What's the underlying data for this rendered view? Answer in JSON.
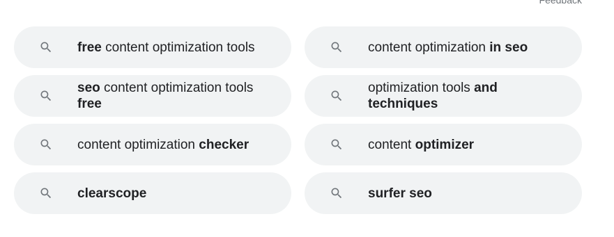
{
  "feedback_label": "Feedback",
  "icon": "search-icon",
  "colors": {
    "pill_background": "#f1f3f4",
    "text": "#202124",
    "icon": "#70757a"
  },
  "suggestions": [
    {
      "parts": [
        {
          "text": "free",
          "bold": true
        },
        {
          "text": " content optimization tools",
          "bold": false
        }
      ]
    },
    {
      "parts": [
        {
          "text": "content optimization ",
          "bold": false
        },
        {
          "text": "in seo",
          "bold": true
        }
      ]
    },
    {
      "parts": [
        {
          "text": "seo",
          "bold": true
        },
        {
          "text": " content optimization tools ",
          "bold": false
        },
        {
          "text": "free",
          "bold": true
        }
      ]
    },
    {
      "parts": [
        {
          "text": "optimization tools ",
          "bold": false
        },
        {
          "text": "and techniques",
          "bold": true
        }
      ]
    },
    {
      "parts": [
        {
          "text": "content optimization ",
          "bold": false
        },
        {
          "text": "checker",
          "bold": true
        }
      ]
    },
    {
      "parts": [
        {
          "text": "content ",
          "bold": false
        },
        {
          "text": "optimizer",
          "bold": true
        }
      ]
    },
    {
      "parts": [
        {
          "text": "clearscope",
          "bold": true
        }
      ]
    },
    {
      "parts": [
        {
          "text": "surfer seo",
          "bold": true
        }
      ]
    }
  ]
}
